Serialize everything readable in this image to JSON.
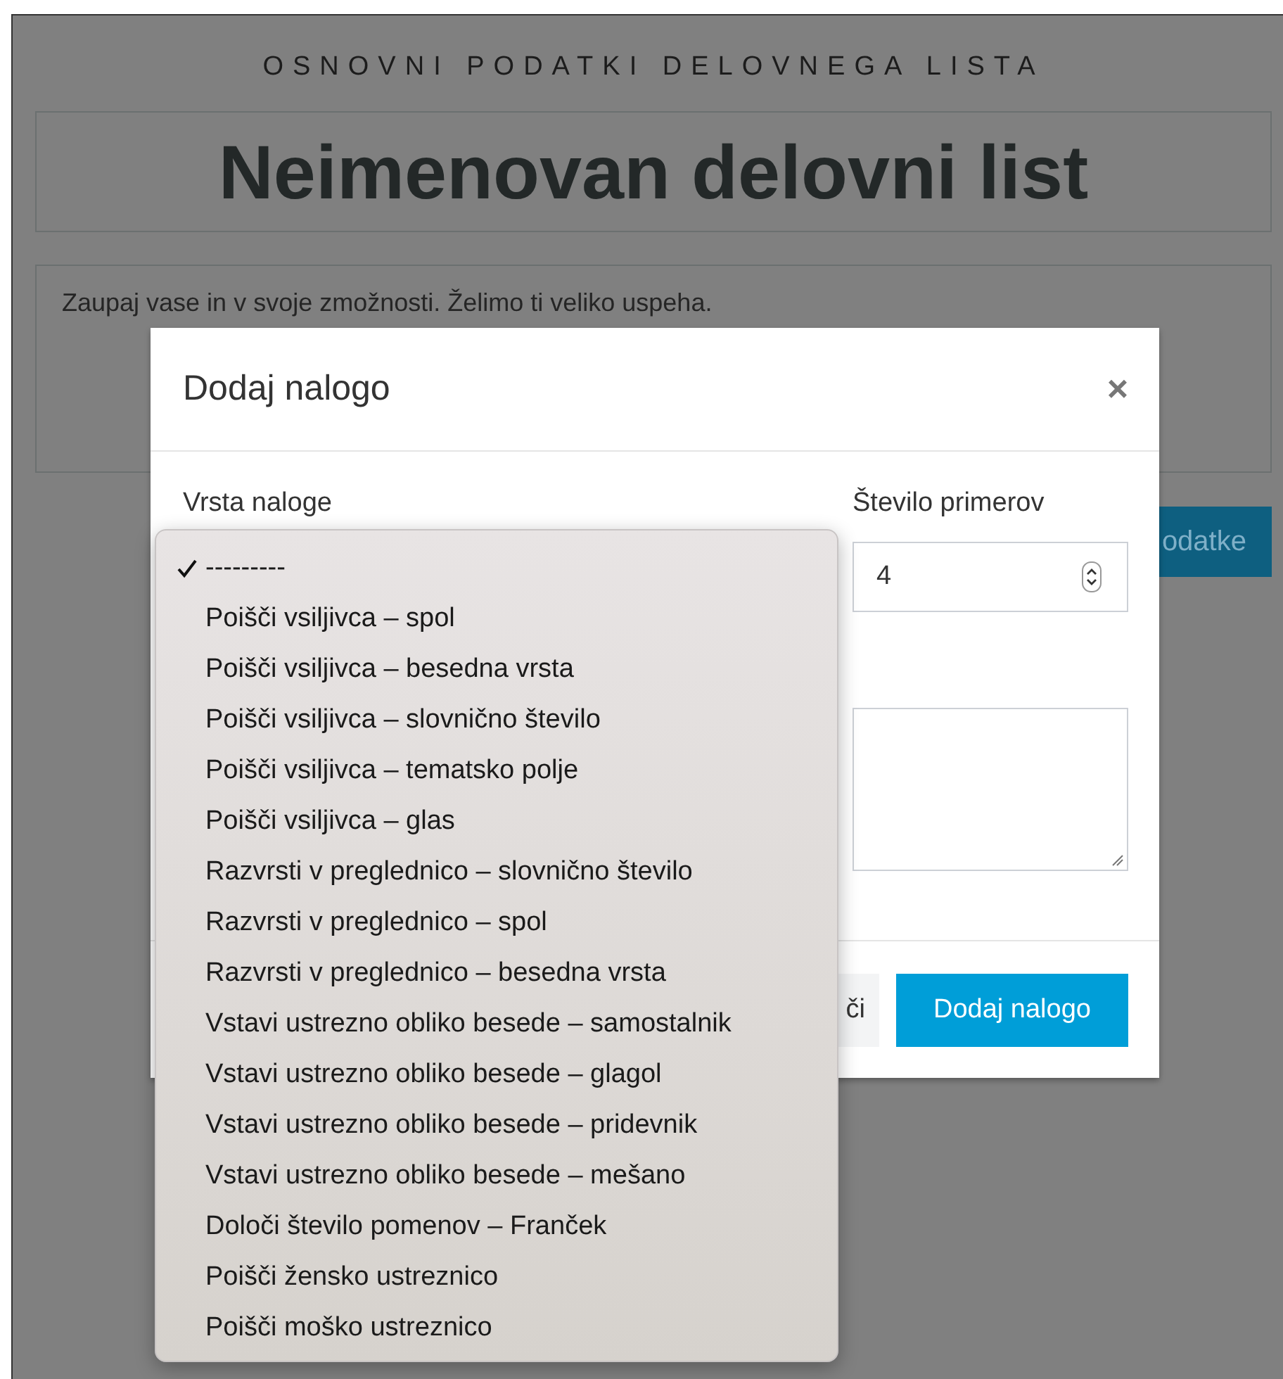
{
  "page": {
    "heading": "OSNOVNI PODATKI DELOVNEGA LISTA",
    "title": "Neimenovan delovni list",
    "description": "Zaupaj vase in v svoje zmožnosti. Želimo ti veliko uspeha.",
    "save_button": "odatke"
  },
  "dialog": {
    "title": "Dodaj nalogo",
    "close": "×",
    "task_type_label": "Vrsta naloge",
    "count_label": "Število primerov",
    "count_value": "4",
    "cancel_button": "či",
    "submit_button": "Dodaj nalogo"
  },
  "dropdown": {
    "options": [
      {
        "label": "---------",
        "selected": true
      },
      {
        "label": "Poišči vsiljivca – spol",
        "selected": false
      },
      {
        "label": "Poišči vsiljivca – besedna vrsta",
        "selected": false
      },
      {
        "label": "Poišči vsiljivca – slovnično število",
        "selected": false
      },
      {
        "label": "Poišči vsiljivca – tematsko polje",
        "selected": false
      },
      {
        "label": "Poišči vsiljivca – glas",
        "selected": false
      },
      {
        "label": "Razvrsti v preglednico – slovnično število",
        "selected": false
      },
      {
        "label": "Razvrsti v preglednico – spol",
        "selected": false
      },
      {
        "label": "Razvrsti v preglednico – besedna vrsta",
        "selected": false
      },
      {
        "label": "Vstavi ustrezno obliko besede – samostalnik",
        "selected": false
      },
      {
        "label": "Vstavi ustrezno obliko besede – glagol",
        "selected": false
      },
      {
        "label": "Vstavi ustrezno obliko besede – pridevnik",
        "selected": false
      },
      {
        "label": "Vstavi ustrezno obliko besede – mešano",
        "selected": false
      },
      {
        "label": "Določi število pomenov – Franček",
        "selected": false
      },
      {
        "label": "Poišči žensko ustreznico",
        "selected": false
      },
      {
        "label": "Poišči moško ustreznico",
        "selected": false
      }
    ]
  }
}
